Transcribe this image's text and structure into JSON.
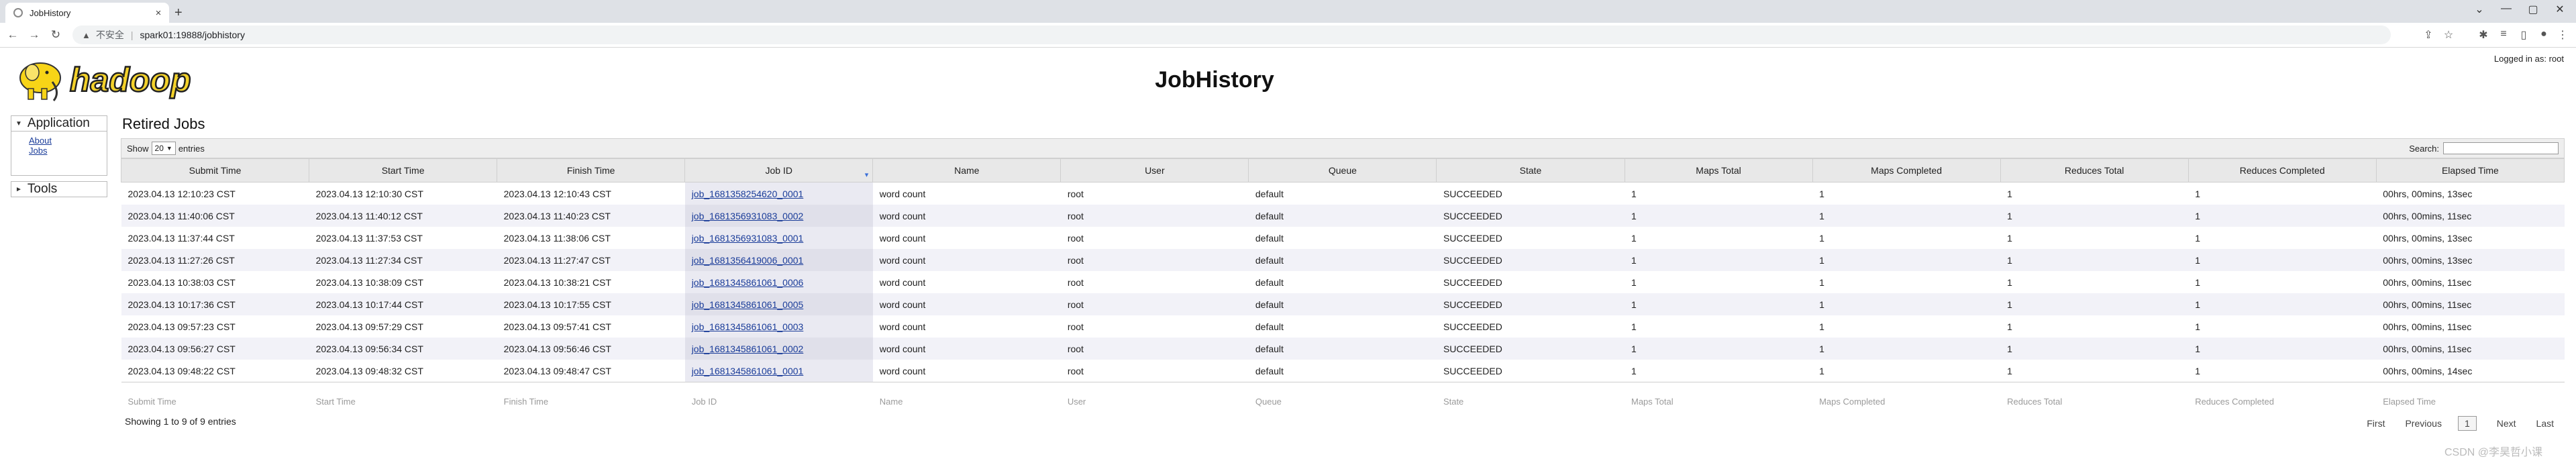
{
  "browser": {
    "tab_title": "JobHistory",
    "tab_close": "×",
    "new_tab": "+",
    "security_label": "不安全",
    "url": "spark01:19888/jobhistory",
    "window_controls": [
      "⌄",
      "—",
      "▢",
      "✕"
    ]
  },
  "page": {
    "logo_text": "hadoop",
    "title": "JobHistory",
    "logged_in": "Logged in as: root"
  },
  "nav": {
    "application_label": "Application",
    "links": [
      "About",
      "Jobs"
    ],
    "tools_label": "Tools"
  },
  "section_title": "Retired Jobs",
  "controls": {
    "show_label": "Show",
    "entries_value": "20",
    "entries_label": "entries",
    "search_label": "Search:"
  },
  "table": {
    "columns": [
      "Submit Time",
      "Start Time",
      "Finish Time",
      "Job ID",
      "Name",
      "User",
      "Queue",
      "State",
      "Maps Total",
      "Maps Completed",
      "Reduces Total",
      "Reduces Completed",
      "Elapsed Time"
    ],
    "rows": [
      [
        "2023.04.13 12:10:23 CST",
        "2023.04.13 12:10:30 CST",
        "2023.04.13 12:10:43 CST",
        "job_1681358254620_0001",
        "word count",
        "root",
        "default",
        "SUCCEEDED",
        "1",
        "1",
        "1",
        "1",
        "00hrs, 00mins, 13sec"
      ],
      [
        "2023.04.13 11:40:06 CST",
        "2023.04.13 11:40:12 CST",
        "2023.04.13 11:40:23 CST",
        "job_1681356931083_0002",
        "word count",
        "root",
        "default",
        "SUCCEEDED",
        "1",
        "1",
        "1",
        "1",
        "00hrs, 00mins, 11sec"
      ],
      [
        "2023.04.13 11:37:44 CST",
        "2023.04.13 11:37:53 CST",
        "2023.04.13 11:38:06 CST",
        "job_1681356931083_0001",
        "word count",
        "root",
        "default",
        "SUCCEEDED",
        "1",
        "1",
        "1",
        "1",
        "00hrs, 00mins, 13sec"
      ],
      [
        "2023.04.13 11:27:26 CST",
        "2023.04.13 11:27:34 CST",
        "2023.04.13 11:27:47 CST",
        "job_1681356419006_0001",
        "word count",
        "root",
        "default",
        "SUCCEEDED",
        "1",
        "1",
        "1",
        "1",
        "00hrs, 00mins, 13sec"
      ],
      [
        "2023.04.13 10:38:03 CST",
        "2023.04.13 10:38:09 CST",
        "2023.04.13 10:38:21 CST",
        "job_1681345861061_0006",
        "word count",
        "root",
        "default",
        "SUCCEEDED",
        "1",
        "1",
        "1",
        "1",
        "00hrs, 00mins, 11sec"
      ],
      [
        "2023.04.13 10:17:36 CST",
        "2023.04.13 10:17:44 CST",
        "2023.04.13 10:17:55 CST",
        "job_1681345861061_0005",
        "word count",
        "root",
        "default",
        "SUCCEEDED",
        "1",
        "1",
        "1",
        "1",
        "00hrs, 00mins, 11sec"
      ],
      [
        "2023.04.13 09:57:23 CST",
        "2023.04.13 09:57:29 CST",
        "2023.04.13 09:57:41 CST",
        "job_1681345861061_0003",
        "word count",
        "root",
        "default",
        "SUCCEEDED",
        "1",
        "1",
        "1",
        "1",
        "00hrs, 00mins, 11sec"
      ],
      [
        "2023.04.13 09:56:27 CST",
        "2023.04.13 09:56:34 CST",
        "2023.04.13 09:56:46 CST",
        "job_1681345861061_0002",
        "word count",
        "root",
        "default",
        "SUCCEEDED",
        "1",
        "1",
        "1",
        "1",
        "00hrs, 00mins, 11sec"
      ],
      [
        "2023.04.13 09:48:22 CST",
        "2023.04.13 09:48:32 CST",
        "2023.04.13 09:48:47 CST",
        "job_1681345861061_0001",
        "word count",
        "root",
        "default",
        "SUCCEEDED",
        "1",
        "1",
        "1",
        "1",
        "00hrs, 00mins, 14sec"
      ]
    ],
    "footer_filters": [
      "Submit Time",
      "Start Time",
      "Finish Time",
      "Job ID",
      "Name",
      "User",
      "Queue",
      "State",
      "Maps Total",
      "Maps Completed",
      "Reduces Total",
      "Reduces Completed",
      "Elapsed Time"
    ]
  },
  "pagination": {
    "info": "Showing 1 to 9 of 9 entries",
    "first": "First",
    "previous": "Previous",
    "current": "1",
    "next": "Next",
    "last": "Last"
  },
  "watermark": "CSDN @李昊哲小课",
  "icons": {
    "back": "back-icon",
    "forward": "forward-icon",
    "reload": "reload-icon",
    "warning": "warning-icon"
  },
  "colors": {
    "link": "#1a3c99",
    "header_bg": "#e8e8e8",
    "row_alt": "#f2f2f8"
  }
}
